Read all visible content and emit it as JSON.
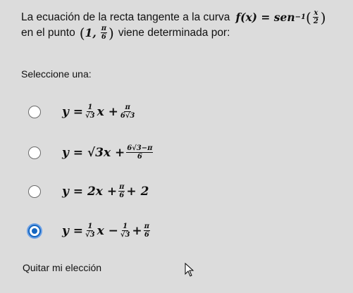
{
  "question": {
    "line1_text": "La ecuación de la recta tangente a la curva",
    "line2_text_before": "en el punto",
    "line2_text_after": "viene determinada por:",
    "function_lhs": "f(x) = sen",
    "function_exponent": "−1",
    "function_arg_num": "x",
    "function_arg_den": "2",
    "point_first": "1,",
    "point_num": "π",
    "point_den": "6"
  },
  "prompt": "Seleccione una:",
  "options": [
    {
      "lhs": "y =",
      "frac1_num": "1",
      "frac1_den": "√3",
      "mid": "x +",
      "frac2_num": "π",
      "frac2_den": "6√3",
      "selected": false
    },
    {
      "lhs": "y = √3x +",
      "frac1_num": "6√3−π",
      "frac1_den": "6",
      "selected": false
    },
    {
      "lhs": "y = 2x +",
      "frac1_num": "π",
      "frac1_den": "6",
      "tail": "+ 2",
      "selected": false
    },
    {
      "lhs": "y =",
      "frac1_num": "1",
      "frac1_den": "√3",
      "mid": "x −",
      "frac2_num": "1",
      "frac2_den": "√3",
      "mid2": "+",
      "frac3_num": "π",
      "frac3_den": "6",
      "selected": true
    }
  ],
  "clear_label": "Quitar mi elección",
  "colors": {
    "background": "#dcdcdc",
    "selected_radio": "#1566c0"
  }
}
